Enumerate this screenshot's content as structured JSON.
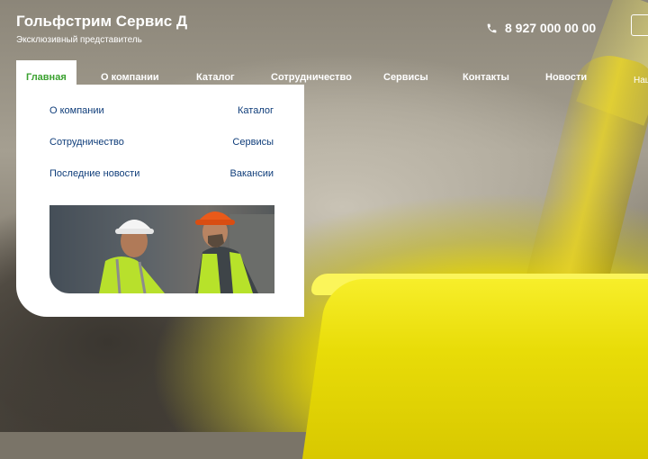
{
  "header": {
    "brand_title": "Гольфстрим Сервис Д",
    "brand_subtitle": "Эксклюзивный представитель",
    "phone": "8 927 000 00 00",
    "phone_icon": "phone-icon"
  },
  "nav": {
    "items": [
      {
        "label": "Главная",
        "active": true
      },
      {
        "label": "О компании"
      },
      {
        "label": "Каталог"
      },
      {
        "label": "Сотрудничество"
      },
      {
        "label": "Сервисы"
      },
      {
        "label": "Контакты"
      },
      {
        "label": "Новости"
      },
      {
        "label": "Наш"
      }
    ]
  },
  "dropdown": {
    "links": [
      {
        "label": "О компании"
      },
      {
        "label": "Каталог"
      },
      {
        "label": "Сотрудничество"
      },
      {
        "label": "Сервисы"
      },
      {
        "label": "Последние новости"
      },
      {
        "label": "Вакансии"
      }
    ]
  },
  "colors": {
    "active_nav": "#3aa12f",
    "dropdown_link": "#0f3d7a",
    "hardhat_orange": "#ea5a1a",
    "vest_green": "#b7e22a"
  }
}
